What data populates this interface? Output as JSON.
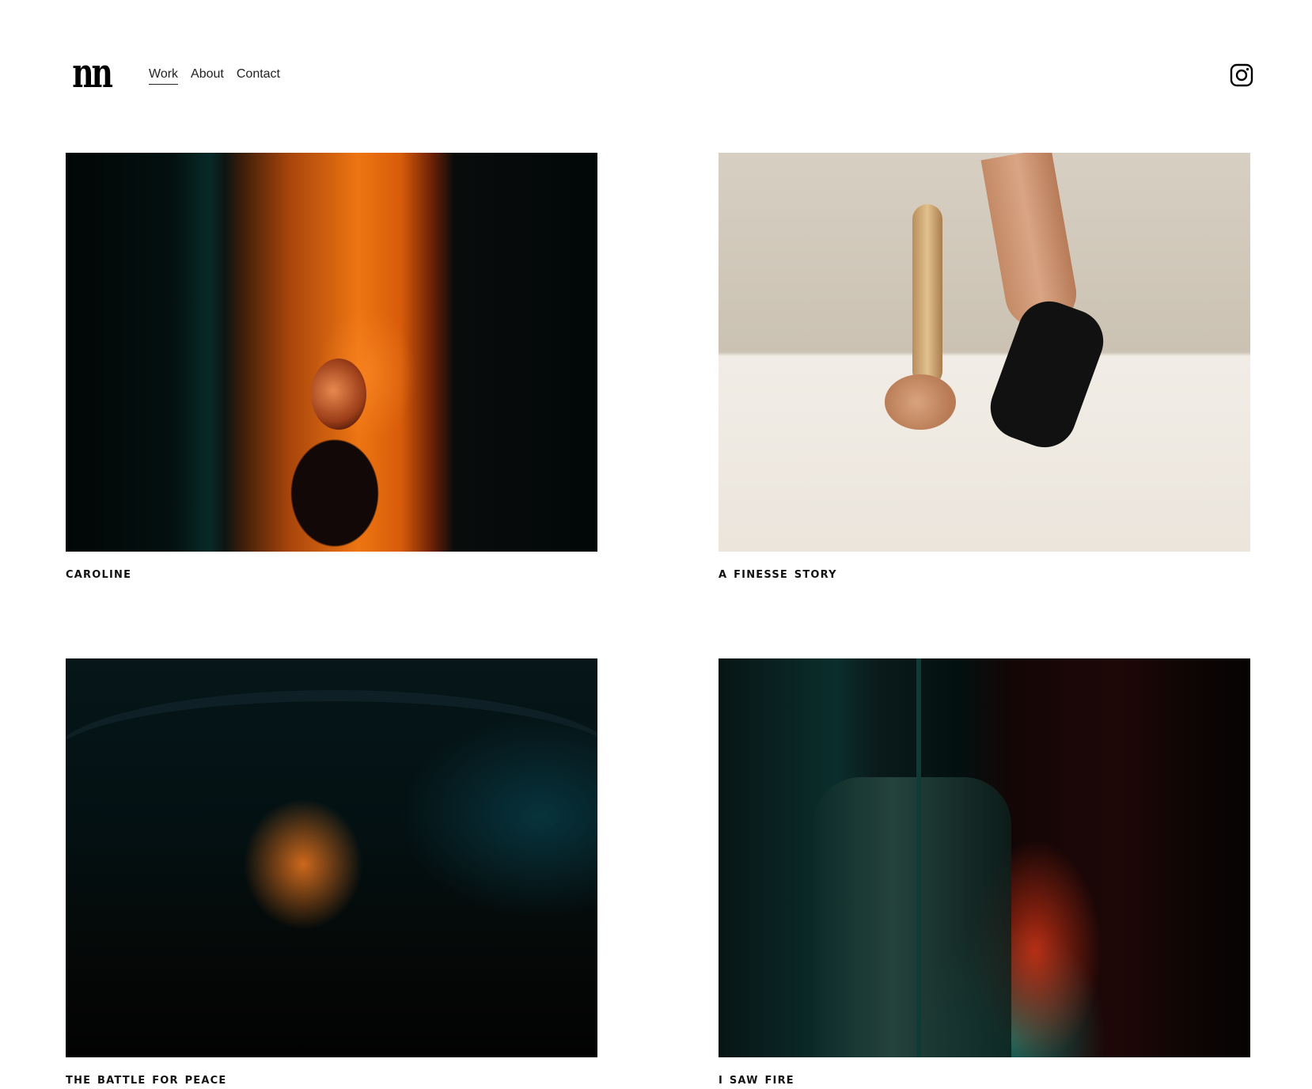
{
  "header": {
    "logo_text": "nn",
    "nav": [
      {
        "label": "Work",
        "active": true
      },
      {
        "label": "About",
        "active": false
      },
      {
        "label": "Contact",
        "active": false
      }
    ],
    "social_icon": "instagram-icon"
  },
  "projects": [
    {
      "title": "caroline",
      "image": "caroline-photo"
    },
    {
      "title": "a finesse story",
      "image": "finesse-photo"
    },
    {
      "title": "the battle for peace",
      "image": "battle-photo"
    },
    {
      "title": "i saw fire",
      "image": "fire-photo"
    }
  ],
  "colors": {
    "background": "#ffffff",
    "text": "#111111"
  }
}
